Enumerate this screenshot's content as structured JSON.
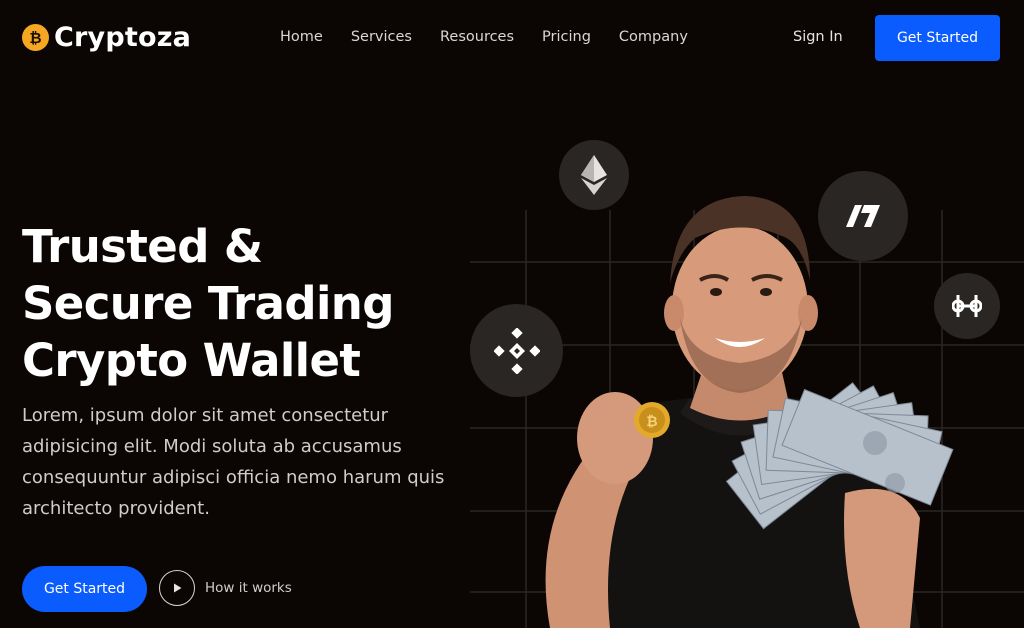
{
  "brand": {
    "name": "Cryptoza",
    "logo_icon": "bitcoin-coin-icon",
    "accent": "#f5a623"
  },
  "nav": {
    "items": [
      {
        "label": "Home"
      },
      {
        "label": "Services"
      },
      {
        "label": "Resources"
      },
      {
        "label": "Pricing"
      },
      {
        "label": "Company"
      }
    ],
    "signin_label": "Sign In",
    "cta_label": "Get Started"
  },
  "hero": {
    "title_lines": [
      "Trusted &",
      "Secure Trading",
      "Crypto Wallet"
    ],
    "description": "Lorem, ipsum dolor sit amet consectetur adipisicing elit. Modi soluta ab accusamus consequuntur adipisci officia nemo harum quis architecto provident.",
    "cta_label": "Get Started",
    "how_label": "How it works"
  },
  "badges": [
    {
      "name": "ethereum-icon"
    },
    {
      "name": "hive-icon"
    },
    {
      "name": "harmony-icon"
    },
    {
      "name": "binance-icon"
    }
  ],
  "colors": {
    "background": "#0b0604",
    "primary": "#0a5cff",
    "badge": "#2a2624"
  }
}
